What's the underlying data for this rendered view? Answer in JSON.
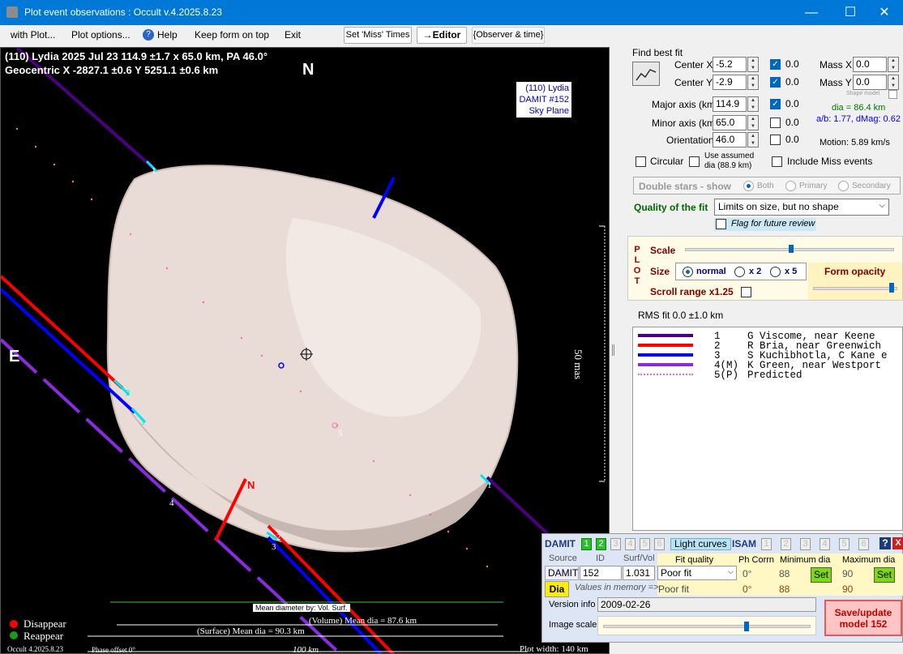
{
  "window": {
    "title": "Plot event observations : Occult v.4.2025.8.23",
    "minimize": "—",
    "maximize": "☐",
    "close": "✕"
  },
  "menu": {
    "items": [
      "with Plot...",
      "Plot options...",
      "Help",
      "Keep form on top",
      "Exit"
    ],
    "set_miss": "Set 'Miss' Times",
    "editor": "→Editor",
    "observer_time": "{Observer & time}"
  },
  "plot": {
    "header_line1": "(110) Lydia  2025 Jul 23   114.9 ±1.7 x 65.0 km,  PA 46.0°",
    "header_line2": "Geocentric  X  -2827.1 ±0.6  Y 5251.1 ±0.6 km",
    "north": "N",
    "east": "E",
    "legend_lines": [
      "(110) Lydia",
      "DAMIT #152",
      "Sky Plane"
    ],
    "scale_vertical": "50 mas",
    "mean_dia_by": "Mean diameter by: Vol. Surf.",
    "volume_dia": "(Volume) Mean dia = 87.6 km",
    "surface_dia": "(Surface) Mean dia = 90.3 km",
    "km_scale": "100 km",
    "plot_width": "Plot width: 140 km",
    "phase_offset": "Phase offset 0°",
    "version": "Occult 4.2025.8.23",
    "disappear": "Disappear",
    "reappear": "Reappear",
    "chord_n_label": "N",
    "chord_labels": [
      "1",
      "2",
      "3",
      "4",
      "5",
      "1",
      "2",
      "3"
    ]
  },
  "fit": {
    "find_best_fit": "Find best fit",
    "center_x_label": "Center X",
    "center_x": "-5.2",
    "center_x_unc": "0.0",
    "center_y_label": "Center Y",
    "center_y": "-2.9",
    "center_y_unc": "0.0",
    "major_label": "Major axis (km)",
    "major": "114.9",
    "major_unc": "0.0",
    "minor_label": "Minor axis (km)",
    "minor": "65.0",
    "minor_unc": "0.0",
    "orient_label": "Orientation",
    "orient": "46.0",
    "orient_unc": "0.0",
    "mass_x_label": "Mass X",
    "mass_x": "0.0",
    "mass_y_label": "Mass Y",
    "mass_y": "0.0",
    "shape_model": "Shape model",
    "dia": "dia = 86.4 km",
    "ab": "a/b: 1.77, dMag: 0.62",
    "motion": "Motion: 5.89 km/s",
    "circular": "Circular",
    "use_assumed": "Use assumed",
    "assumed_dia": "dia (88.9 km)",
    "include_miss": "Include Miss events",
    "double_stars": "Double stars - show",
    "both": "Both",
    "primary": "Primary",
    "secondary": "Secondary",
    "quality_label": "Quality of the fit",
    "quality_value": "Limits on size, but no shape",
    "flag_review": "Flag for future review"
  },
  "plotbox": {
    "letters": [
      "P",
      "L",
      "O",
      "T"
    ],
    "scale": "Scale",
    "size": "Size",
    "normal": "normal",
    "x2": "x 2",
    "x5": "x 5",
    "form_opacity": "Form opacity",
    "scroll_range": "Scroll range x1.25"
  },
  "rms": "RMS fit 0.0 ±1.0 km",
  "observations": [
    {
      "num": "1",
      "text": "G Viscome, near Keene",
      "color": "#4b0082"
    },
    {
      "num": "2",
      "text": "R Bria, near Greenwich",
      "color": "#ff0000"
    },
    {
      "num": "3",
      "text": "S Kuchibhotla, C Kane e",
      "color": "#0000ff"
    },
    {
      "num": "4(M)",
      "text": "K Green, near Westport",
      "color": "#8a2be2"
    },
    {
      "num": "5(P)",
      "text": "Predicted",
      "color": "#ff69b4"
    }
  ],
  "damit": {
    "damit_label": "DAMIT",
    "isam_label": "ISAM",
    "light_curves": "Light curves",
    "nums": [
      "1",
      "2",
      "3",
      "4",
      "5",
      "6"
    ],
    "help": "?",
    "close": "X",
    "source_hdr": "Source",
    "id_hdr": "ID",
    "surfvol_hdr": "Surf/Vol",
    "fitq_hdr": "Fit quality",
    "phcorr_hdr": "Ph Corrn",
    "mindia_hdr": "Minimum dia",
    "maxdia_hdr": "Maximum dia",
    "source": "DAMIT",
    "id": "152",
    "surfvol": "1.031",
    "fit_quality": "Poor fit",
    "ph_corr": "0°",
    "min_dia": "88",
    "max_dia": "90",
    "dia_btn": "Dia",
    "values_in_memory": "Values in memory =>",
    "mem_fit": "Poor fit",
    "mem_ph": "0°",
    "mem_min": "88",
    "mem_max": "90",
    "set": "Set",
    "version_label": "Version info",
    "version": "2009-02-26",
    "image_scale": "Image scale",
    "save_update": "Save/update",
    "model": "model  152"
  }
}
